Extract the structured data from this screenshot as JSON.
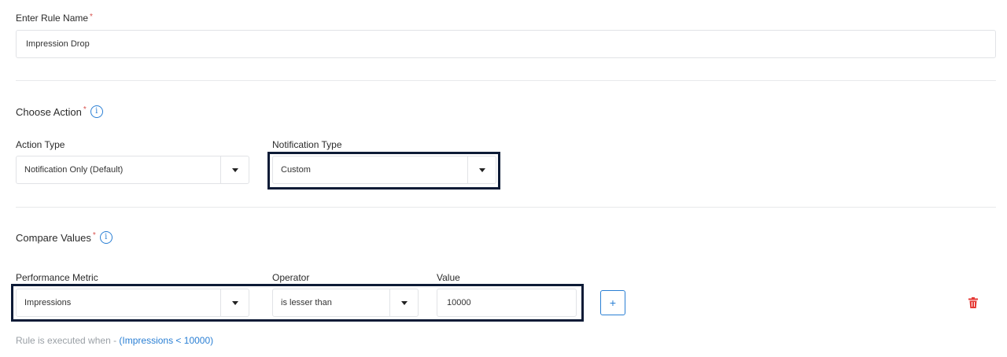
{
  "rule_name": {
    "label": "Enter Rule Name",
    "required_mark": "*",
    "value": "Impression Drop"
  },
  "choose_action": {
    "title": "Choose Action",
    "required_mark": "*",
    "info_glyph": "i",
    "action_type": {
      "label": "Action Type",
      "selected": "Notification Only (Default)"
    },
    "notification_type": {
      "label": "Notification Type",
      "selected": "Custom"
    }
  },
  "compare_values": {
    "title": "Compare Values",
    "required_mark": "*",
    "info_glyph": "i",
    "performance_metric": {
      "label": "Performance Metric",
      "selected": "Impressions"
    },
    "operator": {
      "label": "Operator",
      "selected": "is lesser than"
    },
    "value": {
      "label": "Value",
      "value": "10000"
    },
    "add_button_label": "+",
    "delete_icon": "trash-icon"
  },
  "rule_summary": {
    "prefix": "Rule is executed when - ",
    "expression": "(Impressions < 10000)"
  },
  "colors": {
    "accent": "#2a7fd4",
    "required": "#d9534f",
    "highlight_border": "#0d1b36",
    "delete": "#e53935",
    "muted_text": "#9aa0a6"
  }
}
